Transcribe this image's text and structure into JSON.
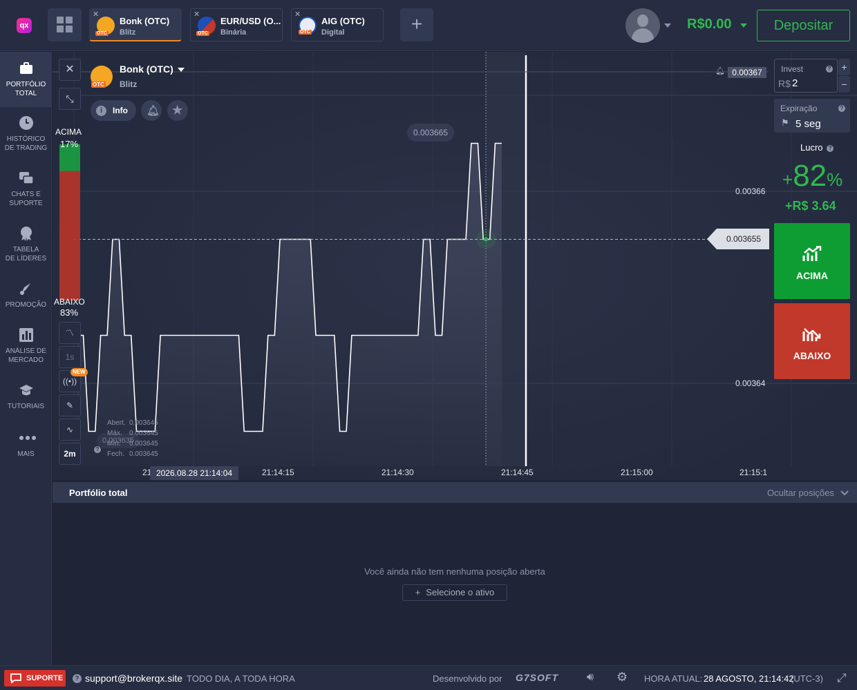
{
  "header": {
    "logo_text": "qx",
    "tabs": [
      {
        "name": "Bonk (OTC)",
        "sub": "Blitz",
        "close": "✕",
        "otc": "OTC"
      },
      {
        "name": "EUR/USD (O...",
        "sub": "Binária",
        "close": "✕",
        "otc": "OTC"
      },
      {
        "name": "AIG (OTC)",
        "sub": "Digital",
        "close": "✕",
        "otc": "OTC"
      }
    ],
    "add_tab": "+",
    "balance": "R$0.00",
    "deposit_label": "Depositar"
  },
  "sidebar": {
    "items": [
      {
        "label1": "PORTFÓLIO",
        "label2": "TOTAL"
      },
      {
        "label1": "HISTÓRICO",
        "label2": "DE TRADING"
      },
      {
        "label1": "CHATS E",
        "label2": "SUPORTE"
      },
      {
        "label1": "TABELA",
        "label2": "DE LÍDERES"
      },
      {
        "label1": "PROMOÇÃO",
        "label2": ""
      },
      {
        "label1": "ANÁLISE DE",
        "label2": "MERCADO"
      },
      {
        "label1": "TUTORIAIS",
        "label2": ""
      },
      {
        "label1": "MAIS",
        "label2": ""
      }
    ]
  },
  "chart": {
    "asset_name": "Bonk (OTC)",
    "asset_type": "Blitz",
    "asset_otc": "OTC",
    "info_label": "Info",
    "sentiment": {
      "up_label": "ACIMA",
      "up_pct": "17%",
      "down_label": "ABAIXO",
      "down_pct": "83%"
    },
    "tools": {
      "interval": "1s",
      "timeframe": "2m",
      "new_badge": "NEW"
    },
    "alert_price": "0.00367",
    "peak_label": "0.003665",
    "current_price": "0.003655",
    "y_labels": [
      "0.00366",
      "0.00364"
    ],
    "x_labels": [
      "21",
      "21:14:15",
      "21:14:30",
      "21:14:45",
      "21:15:00",
      "21:15:1"
    ],
    "hover_time": "2026.08.28 21:14:04",
    "ohlc": {
      "abert_label": "Abert.",
      "abert": "0.003645",
      "max_label": "Máx.",
      "max": "0.003645",
      "min_label": "Mín.",
      "min": "0.003645",
      "fech_label": "Fech.",
      "fech": "0.003645"
    },
    "hover_price": "0.003635",
    "accent_color": "#2fb84f",
    "down_color": "#c1392b"
  },
  "chart_data": {
    "type": "line",
    "x": [
      "21:14:04",
      "21:14:05",
      "21:14:06",
      "21:14:07",
      "21:14:08",
      "21:14:09",
      "21:14:10",
      "21:14:11",
      "21:14:12",
      "21:14:13",
      "21:14:14",
      "21:14:15",
      "21:14:16",
      "21:14:17",
      "21:14:18",
      "21:14:19",
      "21:14:20",
      "21:14:21",
      "21:14:22",
      "21:14:23",
      "21:14:24",
      "21:14:25",
      "21:14:26",
      "21:14:27",
      "21:14:28",
      "21:14:29",
      "21:14:30",
      "21:14:31",
      "21:14:32",
      "21:14:33",
      "21:14:34",
      "21:14:35",
      "21:14:36",
      "21:14:37",
      "21:14:38",
      "21:14:39"
    ],
    "values": [
      0.003645,
      0.003635,
      0.003645,
      0.003655,
      0.003645,
      0.003635,
      0.003635,
      0.003645,
      0.003645,
      0.003645,
      0.003645,
      0.003645,
      0.003645,
      0.003645,
      0.003635,
      0.003635,
      0.003645,
      0.003655,
      0.003655,
      0.003655,
      0.003645,
      0.003645,
      0.003635,
      0.003645,
      0.003645,
      0.003645,
      0.003645,
      0.003645,
      0.003645,
      0.003655,
      0.003645,
      0.003655,
      0.003655,
      0.003665,
      0.003655,
      0.003665
    ],
    "xlabel": "",
    "ylabel": "",
    "ylim": [
      0.00363,
      0.00367
    ],
    "grid": true
  },
  "trade": {
    "invest_label": "Invest",
    "currency": "R$",
    "invest_value": "2",
    "plus": "+",
    "minus": "−",
    "expiry_label": "Expiração",
    "expiry_value": "5 seg",
    "profit_label": "Lucro",
    "profit_pct_sign": "+",
    "profit_pct": "82",
    "profit_pct_unit": "%",
    "profit_amount": "+R$ 3.64",
    "up_label": "ACIMA",
    "down_label": "ABAIXO"
  },
  "portfolio": {
    "title": "Portfólio total",
    "hide_label": "Ocultar posições",
    "empty_text": "Você ainda não tem nenhuma posição aberta",
    "select_label": "Selecione o ativo",
    "select_plus": "+"
  },
  "footer": {
    "support_label": "SUPORTE",
    "email": "support@brokerqx.site",
    "hours": "TODO DIA, A TODA HORA",
    "developed_by": "Desenvolvido por",
    "developer": "G7SOFT",
    "time_label": "HORA ATUAL:",
    "time_value": "28 AGOSTO, 21:14:42",
    "timezone": "(UTC-3)"
  }
}
